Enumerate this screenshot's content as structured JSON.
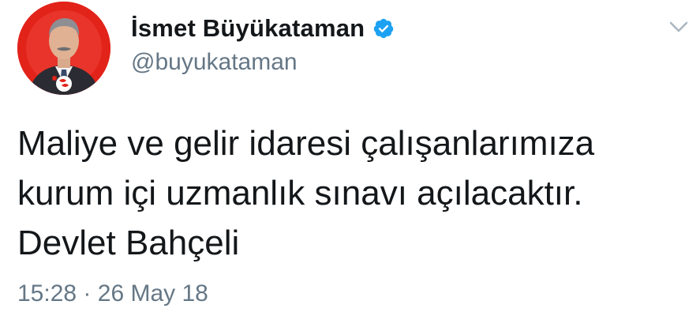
{
  "tweet": {
    "author": {
      "display_name": "İsmet Büyükataman",
      "handle": "@buyukataman",
      "verified": true,
      "verified_icon": "verified-badge-icon",
      "avatar_icon": "profile-photo-avatar"
    },
    "menu_icon": "chevron-down-icon",
    "text_lines": [
      "Maliye ve gelir idaresi çalışanlarımıza",
      "kurum içi uzmanlık sınavı açılacaktır.",
      "Devlet Bahçeli"
    ],
    "time": "15:28",
    "separator": "·",
    "date": "26 May 18"
  },
  "colors": {
    "text": "#14171a",
    "secondary": "#657786",
    "verified_blue": "#1da1f2",
    "avatar_red": "#e2231a"
  }
}
